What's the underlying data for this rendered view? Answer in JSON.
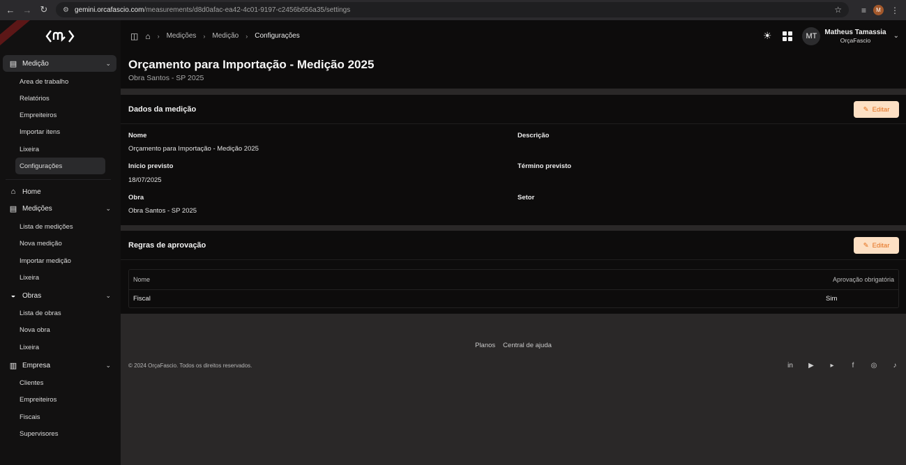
{
  "browser": {
    "url_host": "gemini.orcafascio.com",
    "url_path": "/measurements/d8d0afac-ea42-4c01-9197-c2456b656a35/settings",
    "profile_initial": "M"
  },
  "sidebar": {
    "groups": [
      {
        "label": "Medição",
        "expanded": true,
        "items": [
          "Area de trabalho",
          "Relatórios",
          "Empreiteiros",
          "Importar itens",
          "Lixeira",
          "Configurações"
        ],
        "active_item": "Configurações"
      },
      {
        "label": "Home"
      },
      {
        "label": "Medições",
        "expanded": true,
        "items": [
          "Lista de medições",
          "Nova medição",
          "Importar medição",
          "Lixeira"
        ]
      },
      {
        "label": "Obras",
        "expanded": true,
        "items": [
          "Lista de obras",
          "Nova obra",
          "Lixeira"
        ]
      },
      {
        "label": "Empresa",
        "expanded": true,
        "items": [
          "Clientes",
          "Empreiteiros",
          "Fiscais",
          "Supervisores"
        ]
      }
    ]
  },
  "breadcrumb": [
    "Medições",
    "Medição",
    "Configurações"
  ],
  "user": {
    "initials": "MT",
    "name": "Matheus Tamassia",
    "org": "OrçaFascio"
  },
  "page": {
    "title": "Orçamento para Importação - Medição 2025",
    "subtitle": "Obra Santos - SP 2025"
  },
  "measurement": {
    "header": "Dados da medição",
    "edit_label": "Editar",
    "fields": {
      "nome_label": "Nome",
      "nome_value": "Orçamento para Importação - Medição 2025",
      "descricao_label": "Descrição",
      "descricao_value": "",
      "inicio_label": "Início previsto",
      "inicio_value": "18/07/2025",
      "termino_label": "Término previsto",
      "termino_value": "",
      "obra_label": "Obra",
      "obra_value": "Obra Santos - SP 2025",
      "setor_label": "Setor",
      "setor_value": ""
    }
  },
  "approval": {
    "header": "Regras de aprovação",
    "edit_label": "Editar",
    "columns": [
      "Nome",
      "Aprovação obrigatória"
    ],
    "rows": [
      {
        "nome": "Fiscal",
        "obrigatoria": "Sim"
      }
    ]
  },
  "footer": {
    "links": [
      "Planos",
      "Central de ajuda"
    ],
    "copyright": "© 2024 OrçaFascio. Todos os direitos reservados.",
    "social": [
      "linkedin-icon",
      "google-play-icon",
      "youtube-icon",
      "facebook-icon",
      "instagram-icon",
      "tiktok-icon"
    ]
  },
  "colors": {
    "accent_bg": "#fde0c4",
    "accent_fg": "#e46e1b",
    "panel": "#0d0c0c",
    "background": "#2a2828"
  }
}
